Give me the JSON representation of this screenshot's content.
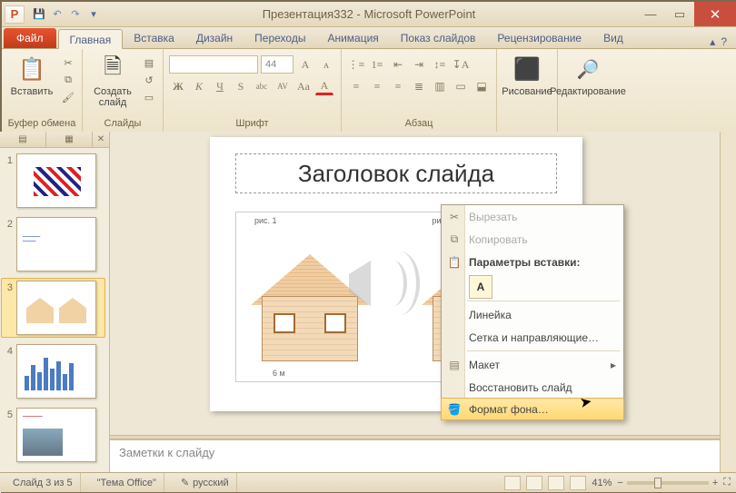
{
  "window": {
    "title_doc": "Презентация332",
    "title_app": "Microsoft PowerPoint"
  },
  "qat": {
    "save": "💾",
    "undo": "↶",
    "redo": "↷",
    "more": "▾"
  },
  "win_buttons": {
    "min": "—",
    "max": "▭",
    "close": "✕"
  },
  "tabs": {
    "file": "Файл",
    "home": "Главная",
    "insert": "Вставка",
    "design": "Дизайн",
    "transitions": "Переходы",
    "anim": "Анимация",
    "slideshow": "Показ слайдов",
    "review": "Рецензирование",
    "view": "Вид"
  },
  "help": {
    "up": "▴",
    "q": "?"
  },
  "groups": {
    "clipboard": {
      "label": "Буфер обмена",
      "paste": "Вставить"
    },
    "slides": {
      "label": "Слайды",
      "new": "Создать\nслайд"
    },
    "font": {
      "label": "Шрифт",
      "size_ph": "44",
      "b": "Ж",
      "i": "К",
      "u": "Ч",
      "s": "S",
      "shadow": "abc",
      "av": "AV",
      "aa": "Aa",
      "a_color": "A"
    },
    "para": {
      "label": "Абзац"
    },
    "draw": {
      "label": "Рисование"
    },
    "edit": {
      "label": "Редактирование"
    }
  },
  "thumbs_tabs": {
    "a": "▤",
    "b": "▦",
    "x": "✕"
  },
  "slide": {
    "title": "Заголовок слайда",
    "fig1": "рис. 1",
    "fig2": "рис. 2",
    "dim": "6 м"
  },
  "context": {
    "cut": "Вырезать",
    "copy": "Копировать",
    "paste_opts": "Параметры вставки:",
    "paste_icon": "A",
    "ruler": "Линейка",
    "grid": "Сетка и направляющие…",
    "layout": "Макет",
    "reset": "Восстановить слайд",
    "format_bg": "Формат фона…"
  },
  "notes": {
    "placeholder": "Заметки к слайду"
  },
  "status": {
    "slide": "Слайд 3 из 5",
    "theme": "\"Тема Office\"",
    "lang": "русский",
    "zoom_pct": "41%"
  },
  "thumbs": [
    "1",
    "2",
    "3",
    "4",
    "5"
  ]
}
